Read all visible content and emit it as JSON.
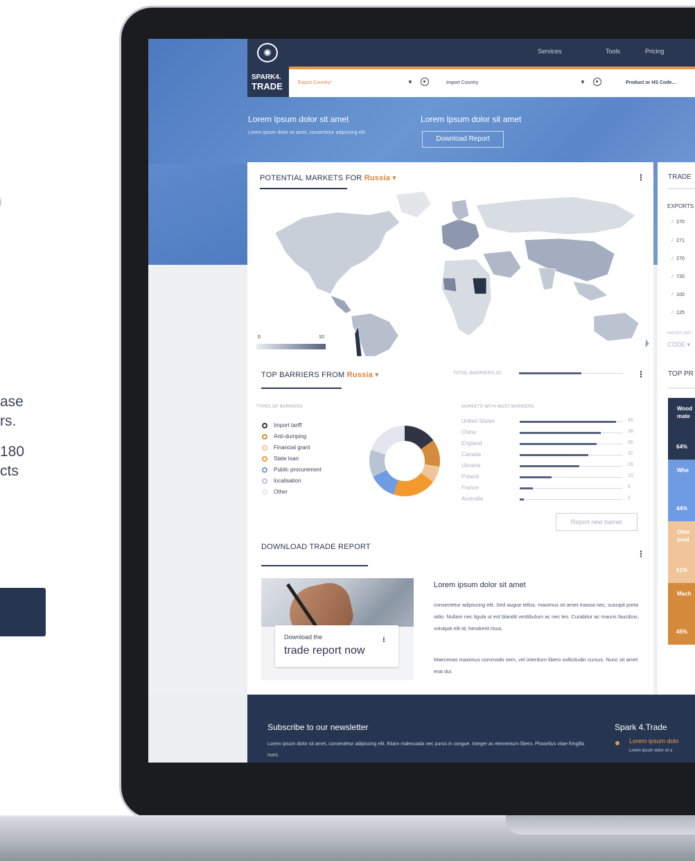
{
  "left_copy": {
    "top_fragment": "O",
    "big_fragment": "t",
    "p1_line1": "ase",
    "p1_line2": "rs.",
    "p2_line1": "180",
    "p2_line2": "cts"
  },
  "app": {
    "logo_line1": "SPARK4.",
    "logo_line2": "TRADE",
    "nav": [
      "Services",
      "Tools",
      "Pricing"
    ],
    "search": {
      "export_placeholder": "Export Country*",
      "import_placeholder": "Import Country",
      "product_placeholder": "Product or HS Code..."
    },
    "hero": {
      "left_title": "Lorem Ipsum dolor sit amet",
      "left_sub": "Lorem ipsum dolor sit amet, consectetur adipiscing elit.",
      "right_title": "Lorem Ipsum dolor sit amet",
      "download_button": "Download Report"
    },
    "markets": {
      "title_prefix": "POTENTIAL MARKETS FOR",
      "country": "Russia",
      "legend_min": "0",
      "legend_max": "10"
    },
    "barriers": {
      "title_prefix": "TOP BARRIERS FROM",
      "country": "Russia",
      "total_label": "TOTAL BARRIERS 32",
      "types_label": "TYPES OF BARRIERS",
      "markets_label": "MARKETS WITH MOST BARRIERS",
      "types": [
        {
          "label": "Import tariff",
          "color": "#2f3542"
        },
        {
          "label": "Anti-dumping",
          "color": "#d48b3c"
        },
        {
          "label": "Financial grant",
          "color": "#f0c59a"
        },
        {
          "label": "State loan",
          "color": "#f39a2e"
        },
        {
          "label": "Public procurement",
          "color": "#6f9be3"
        },
        {
          "label": "localisation",
          "color": "#b9c3d6"
        },
        {
          "label": "Other",
          "color": "#e3e6ec"
        }
      ],
      "donut_values": [
        12,
        10,
        6,
        16,
        10,
        10,
        16
      ],
      "markets": [
        {
          "name": "United States",
          "value": 45
        },
        {
          "name": "China",
          "value": 38
        },
        {
          "name": "England",
          "value": 36
        },
        {
          "name": "Canada",
          "value": 32
        },
        {
          "name": "Ukraine",
          "value": 28
        },
        {
          "name": "Poland",
          "value": 15
        },
        {
          "name": "France",
          "value": 6
        },
        {
          "name": "Australia",
          "value": 2
        }
      ],
      "report_button": "Report new barrier"
    },
    "download_report": {
      "title": "DOWNLOAD TRADE REPORT",
      "card_line1": "Download the",
      "card_line2": "trade report now",
      "article_title": "Lorem ipsum dolor sit amet",
      "article_p1": "consectetur adipiscing elit. Sed augue tellus, maximus sit amet massa nec, suscipit porta odio. Nullam nec ligula ut est blandit vestibulum ac nec leo. Curabitur ac mauris faucibus, volutpat elit id, hendrerit risus.",
      "article_p2": "Maecenas maximus commodo sem, vel interdum libero sollicitudin cursus. Nunc sit amet erat dui."
    },
    "trade_panel": {
      "title": "TRADE",
      "exports_label": "EXPORTS",
      "hs_codes": [
        "270",
        "271",
        "270",
        "720",
        "100",
        "125"
      ],
      "fastest_label": "FASTEST GRO",
      "code_label": "CODE"
    },
    "top_products": {
      "title": "TOP PR",
      "items": [
        {
          "name": "Wood mate",
          "pct": "64%",
          "color": "#2a3752",
          "text": "#ffffff"
        },
        {
          "name": "Whe",
          "pct": "44%",
          "color": "#6f9be3",
          "text": "#ffffff"
        },
        {
          "name": "Othe prod",
          "pct": "61%",
          "color": "#f0c59a",
          "text": "#ffffff"
        },
        {
          "name": "Mach",
          "pct": "45%",
          "color": "#d48b3c",
          "text": "#ffffff"
        }
      ]
    },
    "footer": {
      "subscribe_title": "Subscribe to our newsletter",
      "subscribe_text": "Lorem ipsum dolor sit amet, consectetur adipiscing elit. Etiam malesuada nec purus in congue. Integer ac elementum libero. Phasellus vitae fringilla nunc.",
      "brand": "Spark 4.Trade",
      "link": "Lorem ipsum dolo",
      "link_sub": "Lorem ipsum dolor sit a"
    }
  }
}
